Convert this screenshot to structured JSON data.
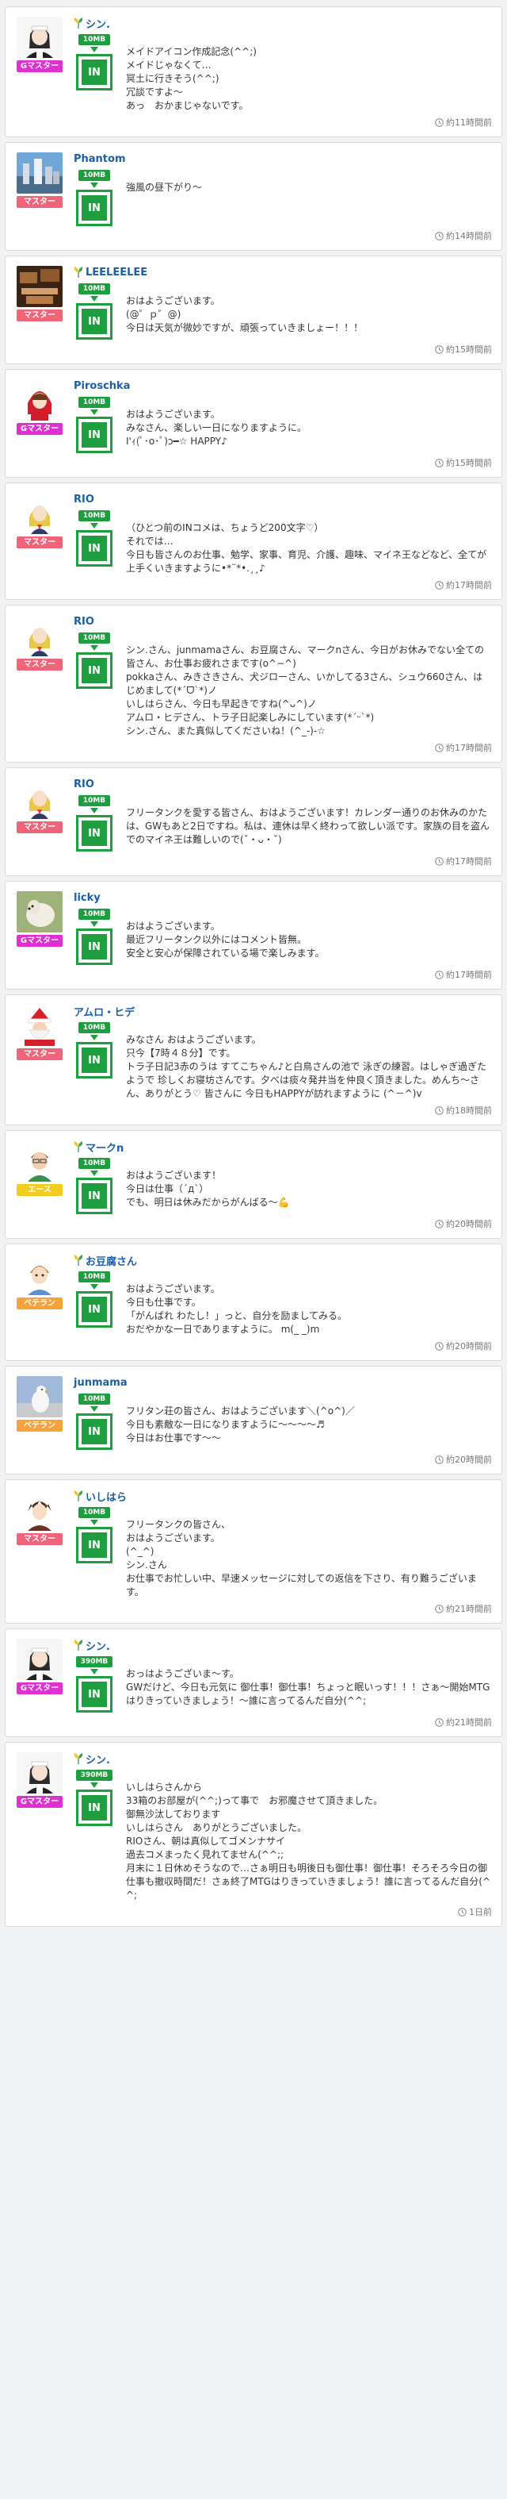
{
  "colors": {
    "rank_gmaster": "#e02fd2",
    "rank_master": "#f0647a",
    "rank_ace": "#f2cd1f",
    "rank_veteran": "#f7a33a",
    "accent_green": "#1e9e3e",
    "name_blue": "#1a5fa6"
  },
  "posts": [
    {
      "name": "シン.",
      "beginner_leaf": true,
      "rank": "Gマスター",
      "rank_color": "#e02fd2",
      "avatar": "maid-avatar",
      "badge": "10MB",
      "in_label": "IN",
      "message": "メイドアイコン作成記念(^^;)\nメイドじゃなくて…\n冥土に行きそう(^^;)\n冗談ですよ〜\nあっ　おかまじゃないです。",
      "time": "約11時間前"
    },
    {
      "name": "Phantom",
      "beginner_leaf": false,
      "rank": "マスター",
      "rank_color": "#f0647a",
      "avatar": "skyline-avatar",
      "badge": "10MB",
      "in_label": "IN",
      "message": "強風の昼下がり〜",
      "time": "約14時間前"
    },
    {
      "name": "LEELEELEE",
      "beginner_leaf": true,
      "rank": "マスター",
      "rank_color": "#f0647a",
      "avatar": "wood-avatar",
      "badge": "10MB",
      "in_label": "IN",
      "message": "おはようございます。\n(@゜ｐ゜@)\n今日は天気が微妙ですが、頑張っていきましょー！！！",
      "time": "約15時間前"
    },
    {
      "name": "Piroschka",
      "beginner_leaf": false,
      "rank": "Gマスター",
      "rank_color": "#e02fd2",
      "avatar": "redhood-avatar",
      "badge": "10MB",
      "in_label": "IN",
      "message": "おはようございます。\nみなさん、楽しい一日になりますように。\nI'ｨ(ﾟ･o･ﾟ)ɔ━☆ HAPPY♪",
      "time": "約15時間前"
    },
    {
      "name": "RIO",
      "beginner_leaf": false,
      "rank": "マスター",
      "rank_color": "#f0647a",
      "avatar": "girl-avatar",
      "badge": "10MB",
      "in_label": "IN",
      "message": "（ひとつ前のINコメは、ちょうど200文字♡）\nそれでは…\n今日も皆さんのお仕事、勉学、家事、育児、介護、趣味、マイネ王などなど、全てが上手くいきますように•*¨*•.¸¸♪",
      "time": "約17時間前"
    },
    {
      "name": "RIO",
      "beginner_leaf": false,
      "rank": "マスター",
      "rank_color": "#f0647a",
      "avatar": "girl-avatar",
      "badge": "10MB",
      "in_label": "IN",
      "message": "シン.さん、junmamaさん、お豆腐さん、マークnさん、今日がお休みでない全ての皆さん、お仕事お疲れさまです(o^−^)\npokkaさん、みきさきさん、犬ジローさん、いかしてる3さん、シュウ660さん、はじめまして(*ˊᗜˋ*)ノ\nいしはらさん、今日も早起きですね(^ᴗ^)ノ\nアムロ・ヒデさん、トラ子日記楽しみにしています(*´ᵕ`*)\nシン.さん、また真似してくださいね！(^_-)-☆",
      "time": "約17時間前"
    },
    {
      "name": "RIO",
      "beginner_leaf": false,
      "rank": "マスター",
      "rank_color": "#f0647a",
      "avatar": "girl-avatar",
      "badge": "10MB",
      "in_label": "IN",
      "message": "フリータンクを愛する皆さん、おはようございます！カレンダー通りのお休みのかたは、GWもあと2日ですね。私は、連休は早く終わって欲しい派です。家族の目を盗んでのマイネ王は難しいので(˘・ᴗ・˘)",
      "time": "約17時間前"
    },
    {
      "name": "licky",
      "beginner_leaf": false,
      "rank": "Gマスター",
      "rank_color": "#e02fd2",
      "avatar": "dog-avatar",
      "badge": "10MB",
      "in_label": "IN",
      "message": "おはようございます。\n最近フリータンク以外にはコメント皆無。\n安全と安心が保障されている場で楽しみます。",
      "time": "約17時間前"
    },
    {
      "name": "アムロ・ヒデ",
      "beginner_leaf": false,
      "rank": "マスター",
      "rank_color": "#f0647a",
      "avatar": "santa-avatar",
      "badge": "10MB",
      "in_label": "IN",
      "message": "みなさん おはようございます。\n只今【7時４８分】です。\nトラ子日記3赤のうは すてこちゃん♪と白鳥さんの池で 泳ぎの練習。はしゃぎ過ぎたようで 珍しくお寝坊さんです。夕べは痰々発井当を仲良く頂きました。めんち〜さん、ありがとう♡ 皆さんに 今日もHAPPYが訪れますように (^－^)v",
      "time": "約18時間前"
    },
    {
      "name": "マークn",
      "beginner_leaf": true,
      "rank": "エース",
      "rank_color": "#f2cd1f",
      "avatar": "man-avatar",
      "badge": "10MB",
      "in_label": "IN",
      "message": "おはようございます！\n今日は仕事（´д`）\nでも、明日は休みだからがんばる〜💪",
      "time": "約20時間前"
    },
    {
      "name": "お豆腐さん",
      "beginner_leaf": true,
      "rank": "ベテラン",
      "rank_color": "#f7a33a",
      "avatar": "boy-avatar",
      "badge": "10MB",
      "in_label": "IN",
      "message": "おはようございます。\n今日も仕事です。\n「がんばれ わたし！」っと、自分を励ましてみる。\nおだやかな一日でありますように。 m(_ _)m",
      "time": "約20時間前"
    },
    {
      "name": "junmama",
      "beginner_leaf": false,
      "rank": "ベテラン",
      "rank_color": "#f7a33a",
      "avatar": "bird-avatar",
      "badge": "10MB",
      "in_label": "IN",
      "message": "フリタン荘の皆さん、おはようございます＼(^o^)／\n今日も素敵な一日になりますように〜〜〜〜♬\n今日はお仕事です〜〜",
      "time": "約20時間前"
    },
    {
      "name": "いしはら",
      "beginner_leaf": true,
      "rank": "マスター",
      "rank_color": "#f0647a",
      "avatar": "anime-avatar",
      "badge": "10MB",
      "in_label": "IN",
      "message": "フリータンクの皆さん、\nおはようございます。\n(^_^)\nシン.さん\nお仕事でお忙しい中、早速メッセージに対しての返信を下さり、有り難うございます。",
      "time": "約21時間前"
    },
    {
      "name": "シン.",
      "beginner_leaf": true,
      "rank": "Gマスター",
      "rank_color": "#e02fd2",
      "avatar": "maid-avatar",
      "badge": "390MB",
      "in_label": "IN",
      "message": "おっはようございま〜す。\nGWだけど、今日も元気に 御仕事！御仕事！ちょっと眠いっす！！！さぁ〜開始MTG はりきっていきましょう！〜誰に言ってるんだ自分(^^;",
      "time": "約21時間前"
    },
    {
      "name": "シン.",
      "beginner_leaf": true,
      "rank": "Gマスター",
      "rank_color": "#e02fd2",
      "avatar": "maid-avatar",
      "badge": "390MB",
      "in_label": "IN",
      "message": "いしはらさんから\n33箱のお部屋が(^^;)って事で　お邪魔させて頂きました。\n御無沙汰しております\nいしはらさん　ありがとうございました。\nRIOさん、朝は真似してゴメンナサイ\n過去コメまったく見れてません(^^;;\n月末に１日休めそうなので…さぁ明日も明後日も御仕事！御仕事！そろそろ今日の御仕事も撤収時間だ！さぁ終了MTGはりきっていきましょう！誰に言ってるんだ自分(^^;",
      "time": "1日前"
    }
  ]
}
